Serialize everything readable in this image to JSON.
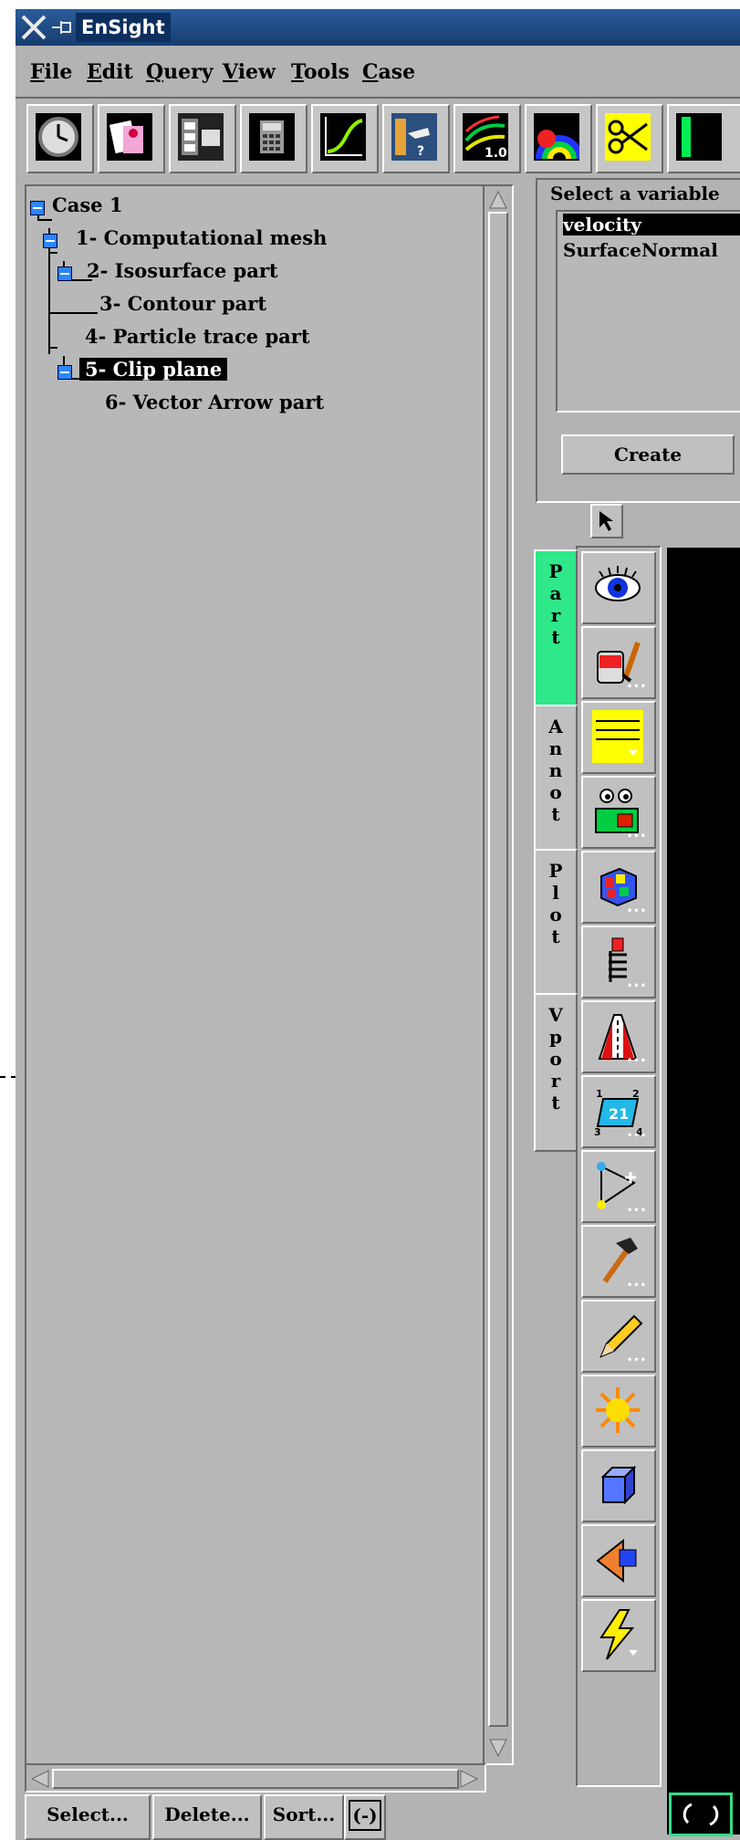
{
  "window": {
    "title": "EnSight"
  },
  "menubar": {
    "items": [
      "File",
      "Edit",
      "Query",
      "View",
      "Tools",
      "Case"
    ],
    "mnemonics": [
      "F",
      "E",
      "Q",
      "V",
      "T",
      "C"
    ]
  },
  "toolbar": {
    "icons": [
      "clock-icon",
      "flipbook-icon",
      "animation-icon",
      "calculator-icon",
      "query-plot-icon",
      "help-icon",
      "contour-scale-icon",
      "color-palette-icon",
      "scissors-icon",
      "more-icon"
    ],
    "contour_label": "1.0"
  },
  "tree": {
    "items": [
      {
        "label": "Case 1",
        "level": 0,
        "expanded": true
      },
      {
        "label": "1- Computational mesh",
        "level": 1,
        "expanded": true
      },
      {
        "label": "2- Isosurface part",
        "level": 2,
        "expanded": true
      },
      {
        "label": "3- Contour part",
        "level": 3
      },
      {
        "label": "4- Particle trace part",
        "level": 2
      },
      {
        "label": "5- Clip plane",
        "level": 2,
        "expanded": true,
        "selected": true
      },
      {
        "label": "6- Vector Arrow part",
        "level": 3
      }
    ]
  },
  "bottom_buttons": {
    "select": "Select...",
    "delete": "Delete...",
    "sort": "Sort...",
    "toggle": "(-)"
  },
  "variable_panel": {
    "label": "Select a variable",
    "variables": [
      "velocity",
      "SurfaceNormal"
    ],
    "selected": "velocity",
    "create": "Create"
  },
  "side_tabs": [
    {
      "label": "Part",
      "letters": [
        "P",
        "a",
        "r",
        "t"
      ],
      "active": true
    },
    {
      "label": "Annot",
      "letters": [
        "A",
        "n",
        "n",
        "o",
        "t"
      ],
      "active": false
    },
    {
      "label": "Plot",
      "letters": [
        "P",
        "l",
        "o",
        "t"
      ],
      "active": false
    },
    {
      "label": "Vport",
      "letters": [
        "V",
        "p",
        "o",
        "r",
        "t"
      ],
      "active": false
    }
  ],
  "tools": [
    "visibility-eye-icon",
    "color-paint-icon",
    "line-style-icon",
    "display-attributes-icon",
    "cube-element-icon",
    "probe-icon",
    "road-view-icon",
    "parallelogram-21-icon",
    "triangle-icon",
    "hammer-icon",
    "pencil-icon",
    "light-sun-icon",
    "box-3d-icon",
    "projection-icon",
    "lightning-icon"
  ],
  "parallelogram_label": "21",
  "parallelogram_corners": [
    "1",
    "2",
    "3",
    "4"
  ],
  "colors": {
    "active_tab": "#2ee88a",
    "title_bar": "#1f4c86",
    "selection": "#000000",
    "tree_box": "#2a86ff"
  }
}
